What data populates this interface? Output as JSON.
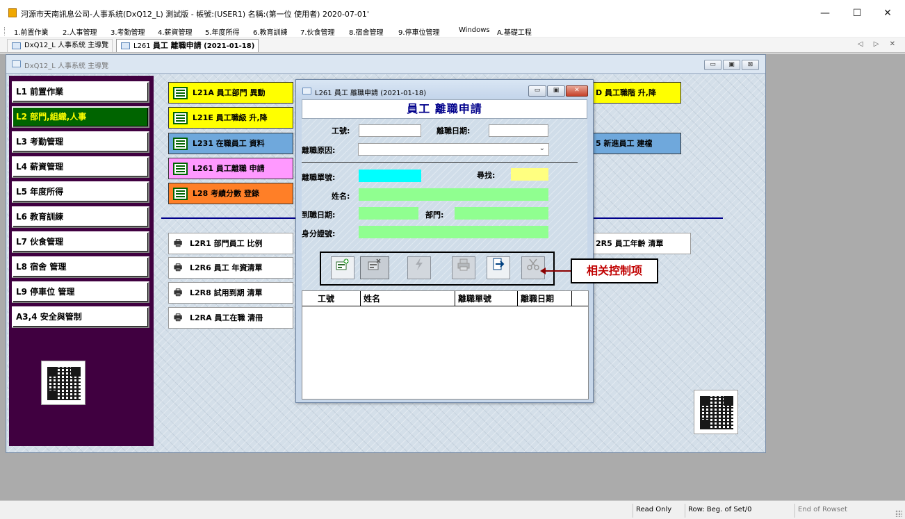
{
  "window": {
    "title": "河源市天南訊息公司-人事系統(DxQ12_L) 測試版 - 帳號:(USER1) 名稱:(第一位 使用者) 2020-07-01'",
    "minimize": "—",
    "maximize": "☐",
    "close": "✕"
  },
  "menu": [
    "1.前置作業",
    "2.人事管理",
    "3.考勤管理",
    "4.薪資管理",
    "5.年度所得",
    "6.教育訓練",
    "7.伙食管理",
    "8.宿舍管理",
    "9.停車位管理",
    "Windows",
    "A.基礎工程"
  ],
  "tabs": [
    {
      "label": "DxQ12_L 人事系統 主導覽"
    },
    {
      "label_prefix": "L261 ",
      "label_bold": "員工 離職申請",
      "label_suffix": " (2021-01-18)"
    }
  ],
  "tab_controls": "◁ ▷ ✕",
  "main_window": {
    "title": "DxQ12_L 人事系統 主導覽",
    "ctrl_min": "▭",
    "ctrl_max": "▣",
    "ctrl_close": "⊠"
  },
  "nav": [
    "L1 前置作業",
    "L2 部門,組織,人事",
    "L3 考勤管理",
    "L4 薪資管理",
    "L5 年度所得",
    "L6 教育訓練",
    "L7 伙食管理",
    "L8 宿舍 管理",
    "L9 停車位 管理",
    "A3,4 安全與管制"
  ],
  "function_buttons": [
    {
      "label": "L21A 員工部門 異動",
      "color": "#ffff00"
    },
    {
      "label": "L21E 員工職級 升,降",
      "color": "#ffff00"
    },
    {
      "label": "L231 在職員工 資料",
      "color": "#6fa8dc"
    },
    {
      "label": "L261 員工離職 申請",
      "color": "#ff99ff"
    },
    {
      "label": "L28 考績分數 登錄",
      "color": "#ff7f27"
    },
    {
      "label": "D 員工職階 升,降",
      "color": "#ffff00"
    },
    {
      "label": "5 新進員工 建檔",
      "color": "#6fa8dc"
    }
  ],
  "report_buttons": [
    "L2R1 部門員工 比例",
    "L2R6 員工 年資清單",
    "L2R8 試用到期 清單",
    "L2RA 員工在職 清冊",
    "2R5 員工年齡 清單"
  ],
  "dialog": {
    "title": "L261 員工 離職申請 (2021-01-18)",
    "header": "員工 離職申請",
    "ctrl_min": "▭",
    "ctrl_max": "▣",
    "ctrl_close": "✕",
    "labels": {
      "emp_no": "工號:",
      "leave_date": "離職日期:",
      "reason": "離職原因:",
      "form_no": "離職單號:",
      "search": "尋找:",
      "name": "姓名:",
      "hire_date": "到職日期:",
      "dept": "部門:",
      "id_no": "身分證號:"
    },
    "values": {
      "emp_no": "",
      "leave_date": "",
      "reason": "",
      "form_no": "",
      "search": "",
      "name": "",
      "hire_date": "",
      "dept": "",
      "id_no": ""
    },
    "colors": {
      "form_no": "#00ffff",
      "search": "#ffff80",
      "green": "#90ff90"
    },
    "toolbar_icons": [
      "add-record-icon",
      "delete-record-icon",
      "flash-icon",
      "print-icon",
      "exit-icon",
      "cut-icon"
    ],
    "grid_columns": [
      "工號",
      "姓名",
      "離職單號",
      "離職日期"
    ]
  },
  "callout": "相关控制项",
  "status": {
    "read_only": "Read Only",
    "row": "Row: Beg. of Set/0",
    "end": "End of Rowset"
  }
}
